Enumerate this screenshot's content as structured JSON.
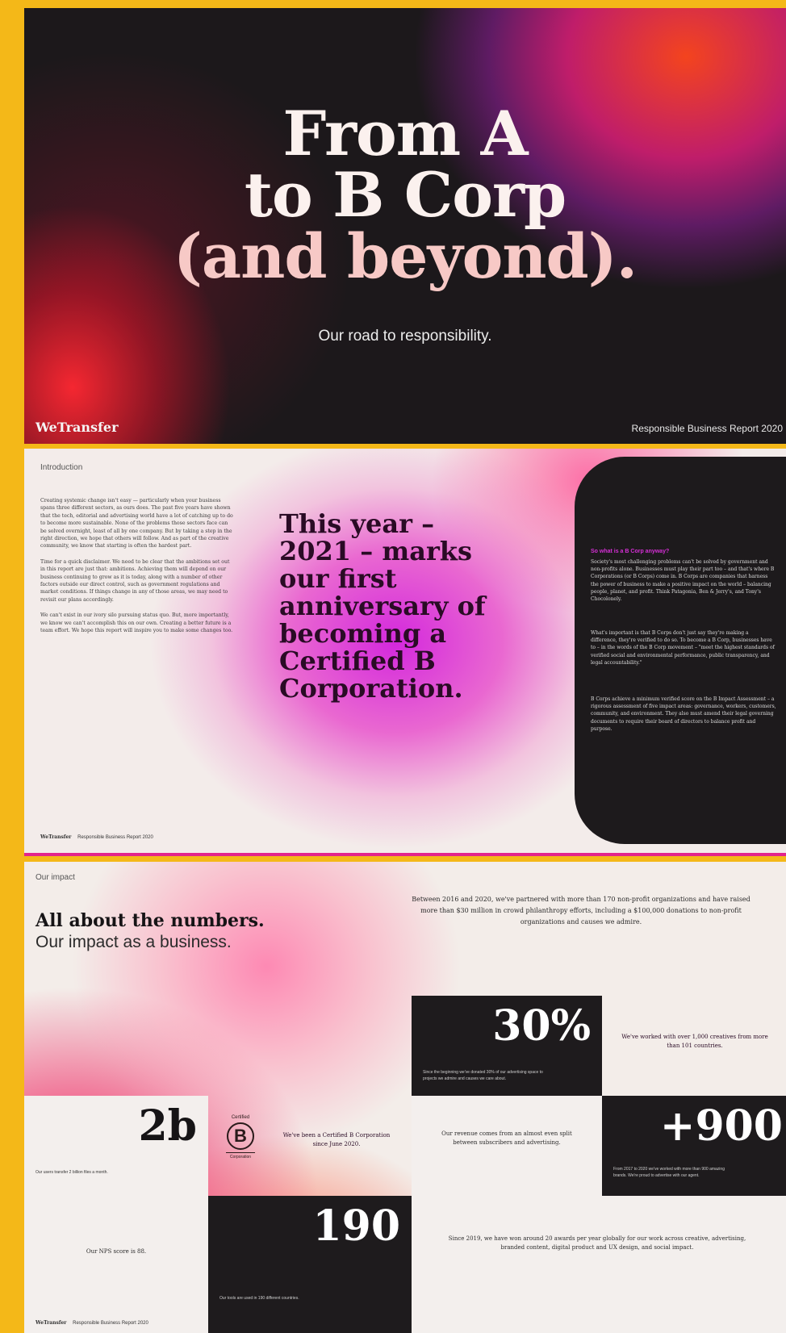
{
  "colors": {
    "frame": "#f4b818",
    "dark": "#1e1b1d",
    "magenta": "#d62fd6",
    "pink_accent": "#e2248c"
  },
  "slide1": {
    "title_lines": [
      "From A",
      "to B Corp",
      "(and beyond)."
    ],
    "subtitle": "Our road to responsibility.",
    "logo": "WeTransfer",
    "report_label": "Responsible Business Report 2020"
  },
  "slide2": {
    "section": "Introduction",
    "body": [
      "Creating systemic change isn't easy — particularly when your business spans three different sectors, as ours does. The past five years have shown that the tech, editorial and advertising world have a lot of catching up to do to become more sustainable. None of the problems those sectors face can be solved overnight, least of all by one company. But by taking a step in the right direction, we hope that others will follow. And as part of the creative community, we know that starting is often the hardest part.",
      "Time for a quick disclaimer. We need to be clear that the ambitions set out in this report are just that: ambitions. Achieving them will depend on our business continuing to grow as it is today, along with a number of other factors outside our direct control, such as government regulations and market conditions. If things change in any of those areas, we may need to revisit our plans accordingly.",
      "We can't exist in our ivory silo pursuing status quo. But, more importantly, we know we can't accomplish this on our own. Creating a better future is a team effort. We hope this report will inspire you to make some changes too."
    ],
    "headline": "This year – 2021 – marks our first anniversary of becoming a Certified B Corporation.",
    "card": {
      "question": "So what is a B Corp anyway?",
      "paragraphs": [
        "Society's most challenging problems can't be solved by government and non-profits alone. Businesses must play their part too – and that's where B Corporations (or B Corps) come in. B Corps are companies that harness the power of business to make a positive impact on the world – balancing people, planet, and profit. Think Patagonia, Ben & Jerry's, and Tony's Chocolonely.",
        "What's important is that B Corps don't just say they're making a difference, they're verified to do so. To become a B Corp, businesses have to – in the words of the B Corp movement – \"meet the highest standards of verified social and environmental performance, public transparency, and legal accountability.\"",
        "B Corps achieve a minimum verified score on the B Impact Assessment – a rigorous assessment of five impact areas: governance, workers, customers, community, and environment. They also must amend their legal governing documents to require their board of directors to balance profit and purpose."
      ]
    },
    "footer_logo": "WeTransfer",
    "footer_label": "Responsible Business Report 2020"
  },
  "slide3": {
    "section": "Our impact",
    "heading": "All about the numbers.",
    "subheading": "Our impact as a business.",
    "intro": "Between 2016 and 2020, we've partnered with more than 170 non-profit organizations and have raised more than $30 million in crowd philanthropy efforts, including a $100,000 donations to non-profit organizations and causes we admire.",
    "stats": {
      "pct": {
        "value": "30%",
        "caption": "Since the beginning we've donated 30% of our advertising space to projects we admire and causes we care about."
      },
      "creatives": {
        "text": "We've worked with over 1,000 creatives from more than 101 countries."
      },
      "users": {
        "value": "2b",
        "caption": "Our users transfer 2 billion files a month."
      },
      "bcorp": {
        "badge_top": "Certified",
        "badge_letter": "B",
        "badge_bottom": "Corporation",
        "text": "We've been a Certified B Corporation since June 2020."
      },
      "revenue": {
        "text": "Our revenue comes from an almost even split between subscribers and advertising."
      },
      "growth": {
        "value": "+900",
        "caption": "From 2017 to 2020 we've worked with more than 900 amazing brands. We're proud to advertise with our agent."
      },
      "nps": {
        "text": "Our NPS score is 88."
      },
      "count": {
        "value": "190",
        "caption": "Our tools are used in 190 different countries."
      },
      "awards": {
        "text": "Since 2019, we have won around 20 awards per year globally for our work across creative, advertising, branded content, digital product and UX design, and social impact."
      }
    },
    "footer_logo": "WeTransfer",
    "footer_label": "Responsible Business Report 2020"
  }
}
